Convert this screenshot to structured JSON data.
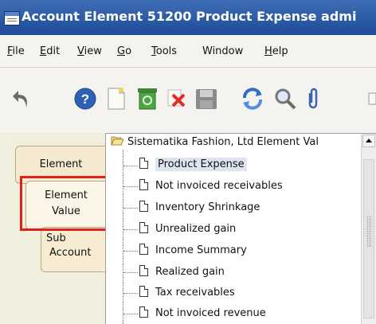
{
  "window": {
    "title": "Account Element  51200  Product Expense  admi"
  },
  "menu": [
    {
      "key": "F",
      "rest": "ile"
    },
    {
      "key": "E",
      "rest": "dit"
    },
    {
      "key": "V",
      "rest": "iew"
    },
    {
      "key": "G",
      "rest": "o"
    },
    {
      "key": "T",
      "rest": "ools"
    },
    {
      "key": "",
      "rest": "Window"
    },
    {
      "key": "H",
      "rest": "elp"
    }
  ],
  "toolbar": {
    "icons": [
      "undo-icon",
      "help-icon",
      "new-record-icon",
      "delete-bin-icon",
      "delete-x-icon",
      "save-icon",
      "refresh-icon",
      "find-icon",
      "attachment-icon"
    ]
  },
  "tabs": {
    "element": "Element",
    "element_value_line1": "Element",
    "element_value_line2": "Value",
    "sub_account_line1": "Sub",
    "sub_account_line2": "Account"
  },
  "tree": {
    "root": "Sistematika Fashion, Ltd Element Val",
    "items": [
      "Product Expense",
      "Not invoiced receivables",
      "Inventory Shrinkage",
      "Unrealized gain",
      "Income Summary",
      "Realized gain",
      "Tax receivables",
      "Not invoiced revenue"
    ],
    "selected": "Product Expense"
  },
  "colors": {
    "title_bar": "#2a5aa8",
    "highlight": "#e0211a",
    "selection": "#dfe5f0"
  }
}
